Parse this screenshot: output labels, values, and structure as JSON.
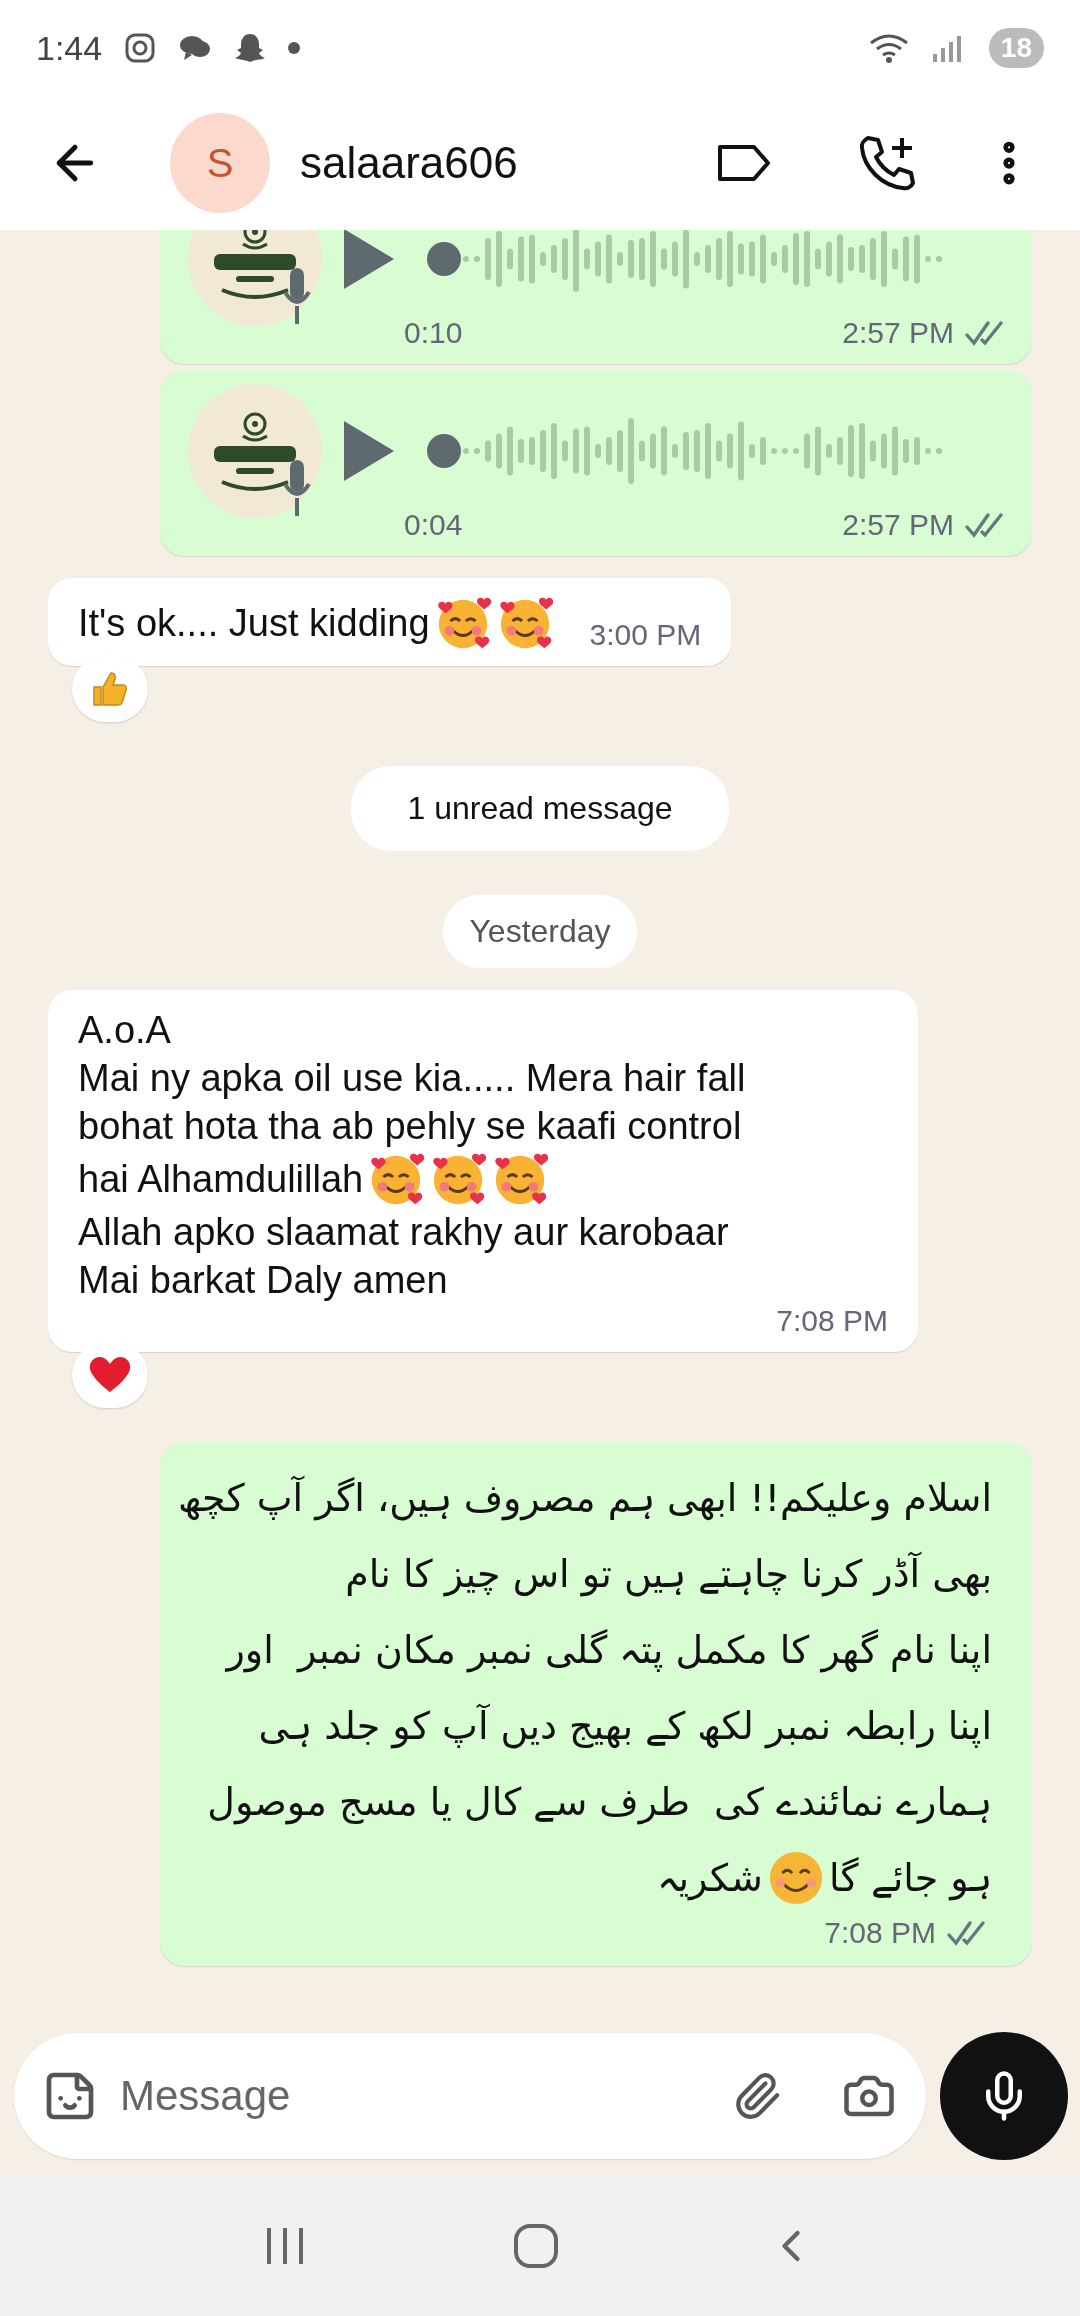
{
  "status_bar": {
    "time": "1:44",
    "battery": "18"
  },
  "header": {
    "avatar_letter": "S",
    "name": "salaara606"
  },
  "messages": [
    {
      "kind": "voice",
      "outgoing": true,
      "clipped": true,
      "duration": "0:10",
      "time": "2:57 PM",
      "read": false
    },
    {
      "kind": "voice",
      "outgoing": true,
      "clipped": false,
      "duration": "0:04",
      "time": "2:57 PM",
      "read": false
    },
    {
      "kind": "text",
      "outgoing": false,
      "lines": [
        [
          {
            "kind": "text",
            "text": "It's ok.... Just kidding"
          },
          {
            "kind": "hearts-emoji"
          },
          {
            "kind": "hearts-emoji"
          }
        ]
      ],
      "time": "3:00 PM",
      "reaction": {
        "kind": "thumbs-up"
      }
    },
    {
      "kind": "unread",
      "text": "1 unread message"
    },
    {
      "kind": "date",
      "text": "Yesterday"
    },
    {
      "kind": "text",
      "outgoing": false,
      "lines": [
        [
          {
            "kind": "text",
            "text": "A.o.A"
          }
        ],
        [
          {
            "kind": "text",
            "text": "Mai ny apka oil use kia..... Mera hair fall"
          }
        ],
        [
          {
            "kind": "text",
            "text": "bohat hota tha ab pehly se kaafi control"
          }
        ],
        [
          {
            "kind": "text",
            "text": "hai Alhamdulillah"
          },
          {
            "kind": "hearts-emoji"
          },
          {
            "kind": "hearts-emoji"
          },
          {
            "kind": "hearts-emoji"
          }
        ],
        [
          {
            "kind": "text",
            "text": "Allah apko slaamat rakhy aur karobaar"
          }
        ],
        [
          {
            "kind": "text",
            "text": "Mai barkat Daly amen"
          }
        ]
      ],
      "time": "7:08 PM",
      "reaction": {
        "kind": "heart"
      }
    },
    {
      "kind": "text",
      "outgoing": true,
      "rtl": true,
      "lines": [
        [
          {
            "kind": "text",
            "text": "اسلام وعلیکم!! ابھی ہم مصروف ہیں، اگر آپ کچھ"
          }
        ],
        [
          {
            "kind": "text",
            "text": "بھی آڈر کرنا چاہتے ہیں تو اس چیز کا نام"
          }
        ],
        [
          {
            "kind": "text",
            "text": "اپنا نام گھر کا مکمل پتہ گلی نمبر مکان نمبر  اور"
          }
        ],
        [
          {
            "kind": "text",
            "text": "اپنا رابطہ نمبر لکھ کے بھیج دیں آپ کو جلد ہی"
          }
        ],
        [
          {
            "kind": "text",
            "text": "ہمارے نمائندے کی  طرف سے کال یا مسج موصول"
          }
        ],
        [
          {
            "kind": "text",
            "text": "ہو جائے گا"
          },
          {
            "kind": "smile-emoji"
          },
          {
            "kind": "text",
            "text": "شکریہ"
          }
        ]
      ],
      "time": "7:08 PM",
      "read": false
    }
  ],
  "composer": {
    "placeholder": "Message"
  }
}
